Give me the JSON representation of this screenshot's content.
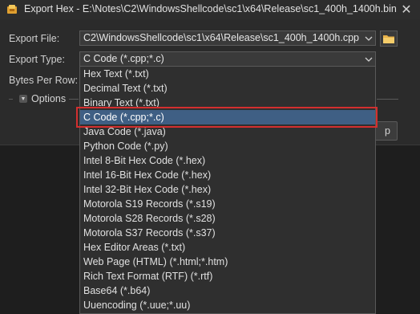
{
  "window": {
    "title": "Export Hex - E:\\Notes\\C2\\WindowsShellcode\\sc1\\x64\\Release\\sc1_400h_1400h.bin",
    "close_symbol": "✕"
  },
  "form": {
    "export_file_label": "Export File:",
    "export_file_value": "C2\\WindowsShellcode\\sc1\\x64\\Release\\sc1_400h_1400h.cpp",
    "export_type_label": "Export Type:",
    "export_type_value": "C Code (*.cpp;*.c)",
    "bytes_per_row_label": "Bytes Per Row:",
    "options_label": "Options",
    "ok_button_partial": "p"
  },
  "dropdown": {
    "selected_index": 3,
    "items": [
      "Hex Text (*.txt)",
      "Decimal Text (*.txt)",
      "Binary Text (*.txt)",
      "C Code (*.cpp;*.c)",
      "Java Code (*.java)",
      "Python Code (*.py)",
      "Intel 8-Bit Hex Code (*.hex)",
      "Intel 16-Bit Hex Code (*.hex)",
      "Intel 32-Bit Hex Code (*.hex)",
      "Motorola S19 Records (*.s19)",
      "Motorola S28 Records (*.s28)",
      "Motorola S37 Records (*.s37)",
      "Hex Editor Areas (*.txt)",
      "Web Page (HTML) (*.html;*.htm)",
      "Rich Text Format (RTF) (*.rtf)",
      "Base64 (*.b64)",
      "Uuencoding (*.uue;*.uu)"
    ]
  },
  "colors": {
    "selection": "#3f5f84",
    "highlight_box": "#d32f2f",
    "background": "#2b2b2b"
  }
}
